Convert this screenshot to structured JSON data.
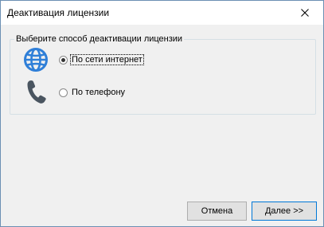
{
  "window": {
    "title": "Деактивация лицензии"
  },
  "icons": {
    "close": "close-icon",
    "internet": "globe-icon",
    "phone": "phone-icon"
  },
  "group": {
    "legend": "Выберите способ деактивации лицензии",
    "options": [
      {
        "label": "По сети интернет",
        "selected": true,
        "icon": "globe-icon"
      },
      {
        "label": "По телефону",
        "selected": false,
        "icon": "phone-icon"
      }
    ]
  },
  "buttons": {
    "cancel": "Отмена",
    "next": "Далее >>"
  },
  "colors": {
    "accent": "#0078d7",
    "globe": "#2f7fd8",
    "phone": "#4a5560"
  }
}
